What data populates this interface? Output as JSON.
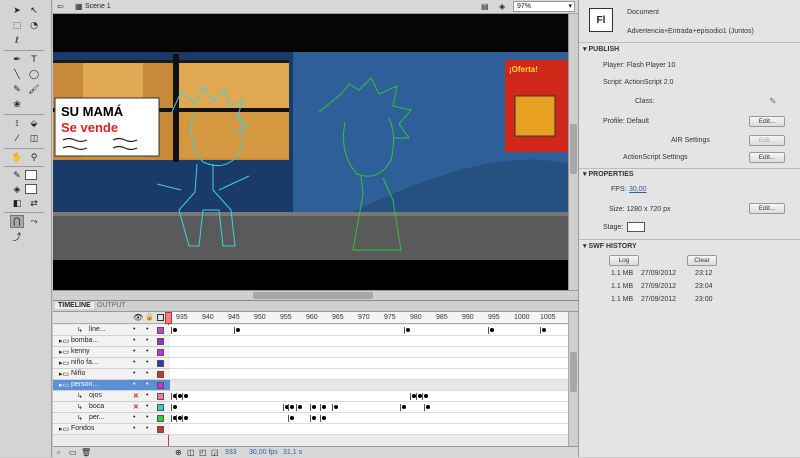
{
  "editbar": {
    "scene": "Scene 1",
    "zoom": "97%"
  },
  "timeline": {
    "tabs": [
      "TIMELINE",
      "OUTPUT"
    ],
    "ruler": [
      "935",
      "940",
      "945",
      "950",
      "955",
      "960",
      "965",
      "970",
      "975",
      "980",
      "985",
      "990",
      "995",
      "1000",
      "1005"
    ],
    "layers": [
      {
        "name": "line...",
        "type": "layer",
        "color": "#cc44cc",
        "lock": "•"
      },
      {
        "name": "bomba...",
        "type": "folder",
        "color": "#9933cc",
        "lock": "•"
      },
      {
        "name": "kenny",
        "type": "folder",
        "color": "#cc33cc",
        "lock": "•"
      },
      {
        "name": "niño fa...",
        "type": "folder",
        "color": "#3333cc",
        "lock": "•"
      },
      {
        "name": "Niño",
        "type": "folder",
        "color": "#cc3333",
        "lock": "•"
      },
      {
        "name": "person...",
        "type": "folder",
        "color": "#cc33cc",
        "lock": "•",
        "selected": true
      },
      {
        "name": "ojos",
        "type": "layer",
        "color": "#ff77aa",
        "hidden": true
      },
      {
        "name": "boca",
        "type": "layer",
        "color": "#33cccc",
        "hidden": true
      },
      {
        "name": "per...",
        "type": "layer",
        "color": "#33cc33",
        "lock": "•"
      },
      {
        "name": "Fondos",
        "type": "folder",
        "color": "#cc3333",
        "lock": "•"
      }
    ],
    "status": {
      "frame": "933",
      "fps": "30,00 fps",
      "time": "31,1 s"
    }
  },
  "stage": {
    "sign_line1": "SU MAMÁ",
    "sign_line2": "Se vende",
    "poster_title": "¡Oferta!"
  },
  "props": {
    "doc_icon": "Fl",
    "doc_type": "Document",
    "doc_name": "Advertencia+Entrada+episodio1 (Juntos)",
    "publish_head": "PUBLISH",
    "player": "Player: Flash Player 10",
    "script": "Script: ActionScript 2.0",
    "class_label": "Class:",
    "profile": "Profile: Default",
    "edit": "Edit...",
    "air": "AIR Settings",
    "as_settings": "ActionScript Settings",
    "properties_head": "PROPERTIES",
    "fps_label": "FPS:",
    "fps_value": "30,00",
    "size": "Size: 1280 x 720 px",
    "stage_label": "Stage:",
    "history_head": "SWF HISTORY",
    "log": "Log",
    "clear": "Clear",
    "history": [
      {
        "size": "1.1 MB",
        "date": "27/09/2012",
        "time": "23:12"
      },
      {
        "size": "1.1 MB",
        "date": "27/09/2012",
        "time": "23:04"
      },
      {
        "size": "1.1 MB",
        "date": "27/09/2012",
        "time": "23:00"
      }
    ]
  }
}
